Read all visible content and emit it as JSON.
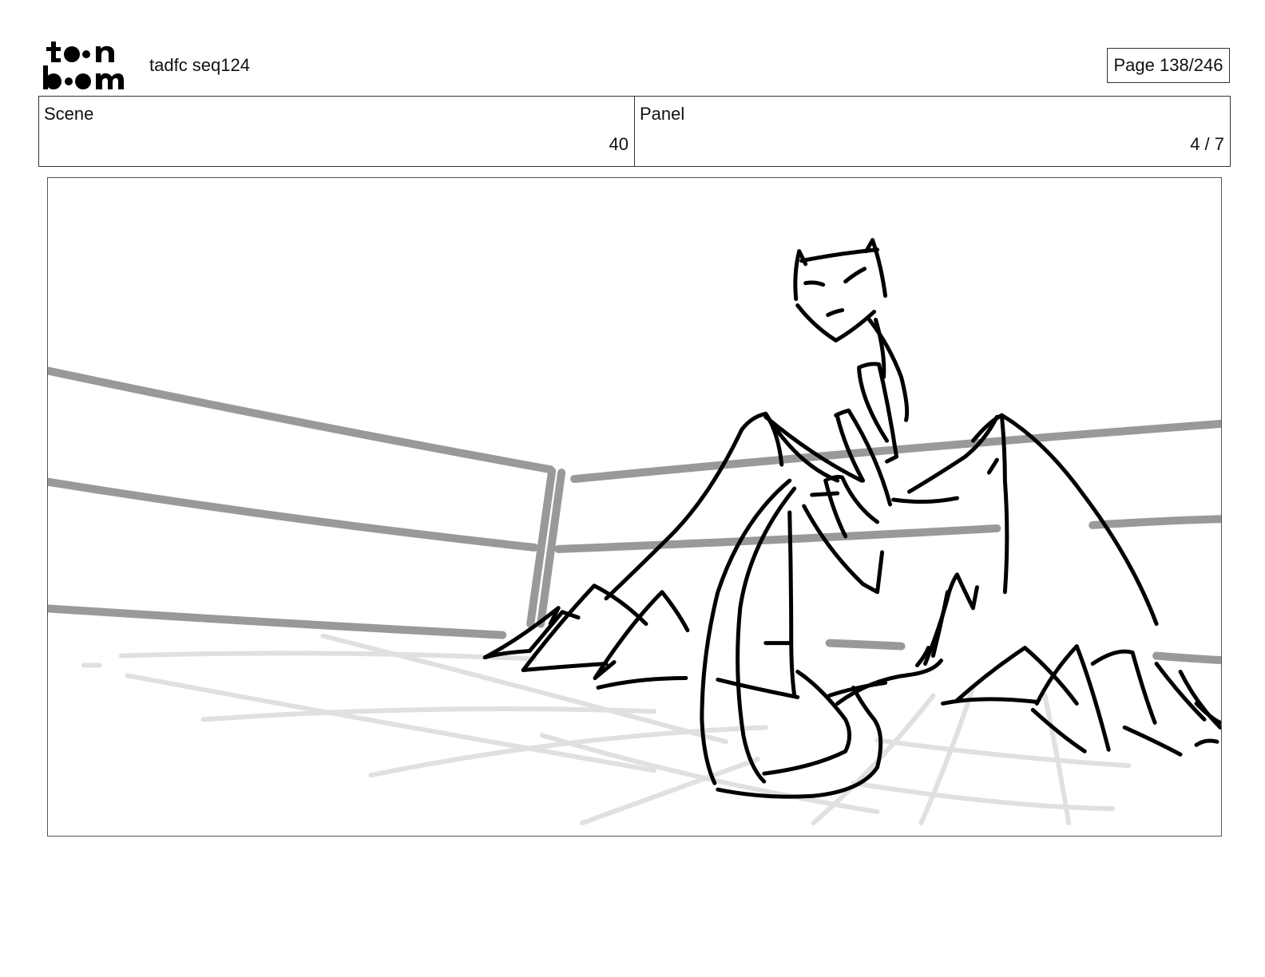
{
  "header": {
    "logo_text": "toon boom",
    "project_title": "tadfc seq124",
    "page_indicator": "Page 138/246"
  },
  "info": {
    "scene_label": "Scene",
    "scene_value": "40",
    "panel_label": "Panel",
    "panel_value": "4 / 7"
  },
  "panel": {
    "drawing": "storyboard-sketch"
  },
  "colors": {
    "ink": "#000000",
    "ring_ropes": "#999999",
    "floor_lines": "#e0e0e0",
    "border": "#333333"
  }
}
